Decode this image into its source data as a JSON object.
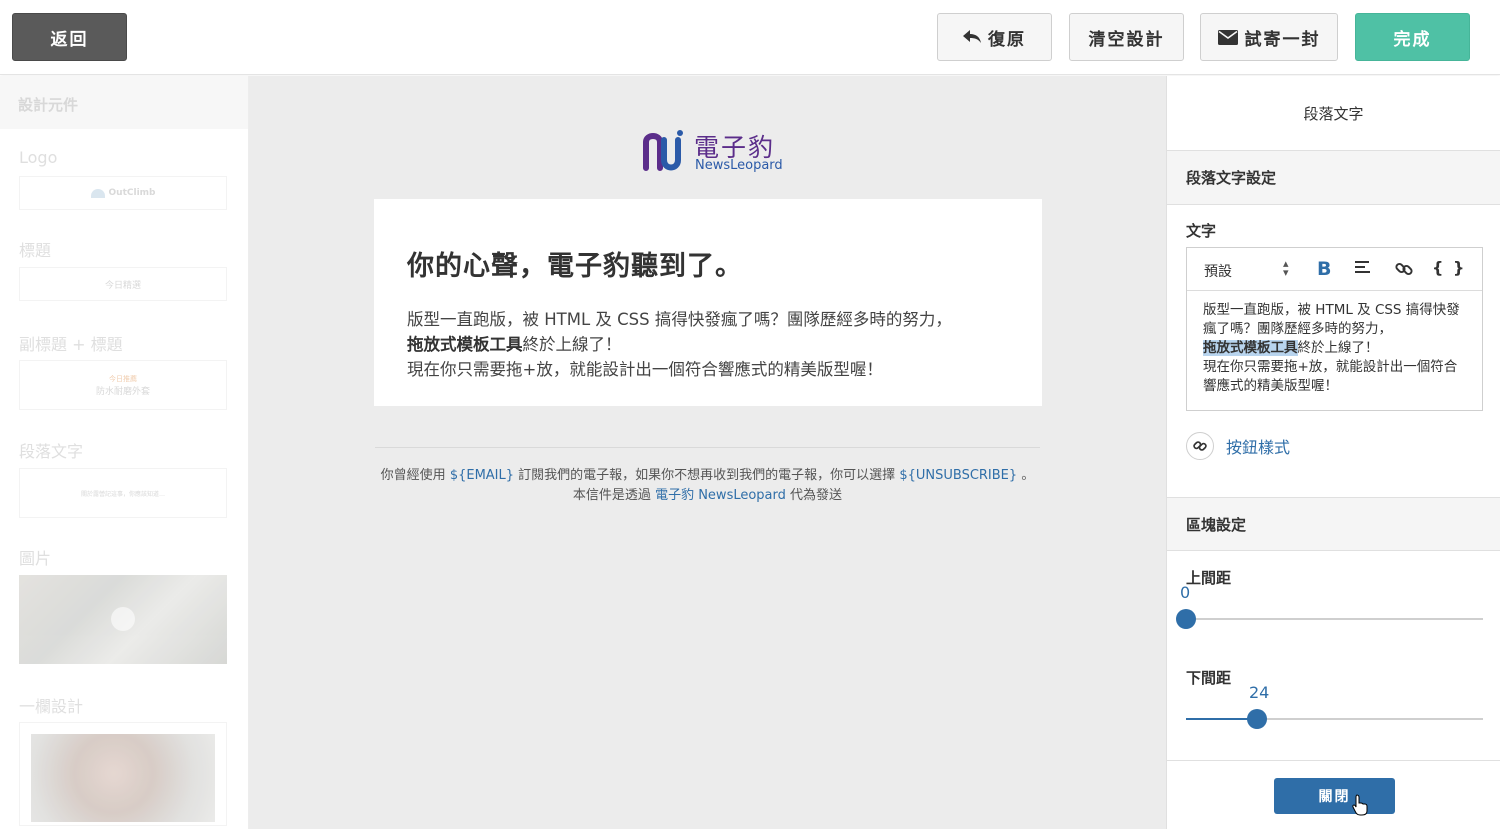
{
  "topbar": {
    "back_label": "返回",
    "undo_label": "復原",
    "clear_label": "清空設計",
    "test_label": "試寄一封",
    "done_label": "完成",
    "done_color": "#4fc1a5"
  },
  "sidebar": {
    "header": "設計元件",
    "items": [
      {
        "label": "Logo",
        "preview": "OutClimb"
      },
      {
        "label": "標題",
        "preview": "今日精選"
      },
      {
        "label": "副標題 + 標題",
        "preview_sub": "今日推薦",
        "preview": "防水耐磨外套"
      },
      {
        "label": "段落文字",
        "preview": "關於露營記這事，你應該知道…"
      },
      {
        "label": "圖片"
      },
      {
        "label": "一欄設計"
      }
    ]
  },
  "canvas": {
    "logo_cn": "電子豹",
    "logo_en": "NewsLeopard",
    "card_title": "你的心聲，電子豹聽到了。",
    "body_line1": "版型一直跑版，被 HTML 及 CSS 搞得快發瘋了嗎？團隊歷經多時的努力，",
    "body_bold": "拖放式模板工具",
    "body_line2_rest": "終於上線了！",
    "body_line3": "現在你只需要拖+放，就能設計出一個符合響應式的精美版型喔！",
    "footer_pre": "你曾經使用",
    "footer_email": "${EMAIL}",
    "footer_mid": "訂閱我們的電子報，如果你不想再收到我們的電子報，你可以選擇",
    "footer_unsub": "${UNSUBSCRIBE}",
    "footer_end": "。",
    "footer2_pre": "本信件是透過",
    "footer2_link": "電子豹 NewsLeopard",
    "footer2_end": "代為發送"
  },
  "panel": {
    "title": "段落文字",
    "section1": "段落文字設定",
    "text_label": "文字",
    "format_select": "預設",
    "bold_glyph": "B",
    "brace_glyph": "{ }",
    "editor_line1": "版型一直跑版，被 HTML 及 CSS 搞得快發",
    "editor_line2": "瘋了嗎？團隊歷經多時的努力，",
    "editor_bold": "拖放式模板工具",
    "editor_line3_rest": "終於上線了！",
    "editor_line4": "現在你只需要拖+放，就能設計出一個符合",
    "editor_line5": "響應式的精美版型喔！",
    "button_style_label": "按鈕樣式",
    "section2": "區塊設定",
    "top_spacing_label": "上間距",
    "top_spacing_value": "0",
    "top_spacing_fraction": 0,
    "bottom_spacing_label": "下間距",
    "bottom_spacing_value": "24",
    "bottom_spacing_fraction": 0.24,
    "close_label": "關閉",
    "accent_color": "#2f6ea8"
  }
}
